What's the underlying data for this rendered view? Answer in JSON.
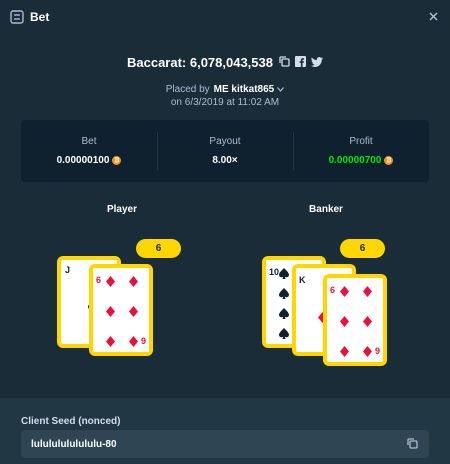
{
  "header": {
    "title": "Bet",
    "icon": "bet-list-icon",
    "close_icon": "close-icon"
  },
  "game": {
    "label": "Baccarat: 6,078,043,538",
    "icons": [
      "copy-icon",
      "facebook-icon",
      "twitter-icon"
    ]
  },
  "placed": {
    "prefix": "Placed by",
    "user": "ME kitkat865",
    "date": "on 6/3/2019 at 11:02 AM"
  },
  "stats": {
    "bet_label": "Bet",
    "bet_value": "0.00000100",
    "payout_label": "Payout",
    "payout_value": "8.00×",
    "profit_label": "Profit",
    "profit_value": "0.00000700",
    "currency_icon": "bitcoin-icon",
    "profit_color": "#00e701"
  },
  "player": {
    "label": "Player",
    "score": "6",
    "cards": [
      {
        "rank": "J",
        "suit": "spades",
        "color": "black"
      },
      {
        "rank": "6",
        "suit": "diamonds",
        "color": "red"
      }
    ]
  },
  "banker": {
    "label": "Banker",
    "score": "6",
    "cards": [
      {
        "rank": "10",
        "suit": "spades",
        "color": "black"
      },
      {
        "rank": "K",
        "suit": "diamonds",
        "color": "red"
      },
      {
        "rank": "6",
        "suit": "diamonds",
        "color": "red"
      }
    ]
  },
  "card_labels": {
    "player_card2_corner": "9",
    "banker_card3_corner": "9"
  },
  "client_seed": {
    "label": "Client Seed (nonced)",
    "value": "lulululululululu-80",
    "copy_icon": "copy-icon"
  },
  "colors": {
    "background": "#1a2c38",
    "panel": "#0f212e",
    "accent": "#ffd600",
    "red": "#e9113c"
  }
}
